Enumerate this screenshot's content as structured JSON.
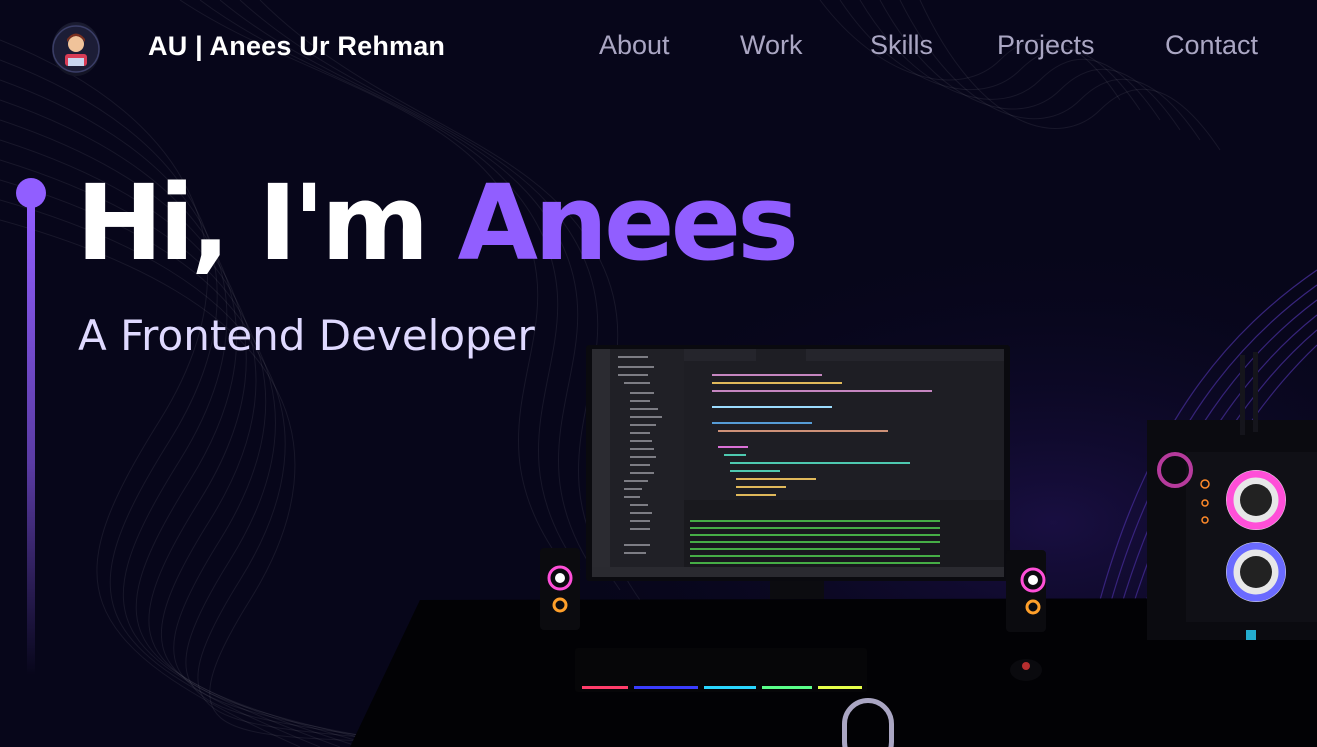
{
  "nav": {
    "brand": "AU  | Anees Ur Rehman",
    "links": [
      {
        "label": "About"
      },
      {
        "label": "Work"
      },
      {
        "label": "Skills"
      },
      {
        "label": "Projects"
      },
      {
        "label": "Contact"
      }
    ]
  },
  "hero": {
    "greeting": "Hi, I'm ",
    "name": "Anees",
    "subtitle": "A Frontend Developer"
  },
  "colors": {
    "accent": "#915eff",
    "background": "#07061a",
    "nav_text": "#aaa6c3",
    "subtitle": "#dfd9ff"
  },
  "icons": {
    "logo": "avatar-logo-icon",
    "scroll": "scroll-indicator-icon"
  }
}
